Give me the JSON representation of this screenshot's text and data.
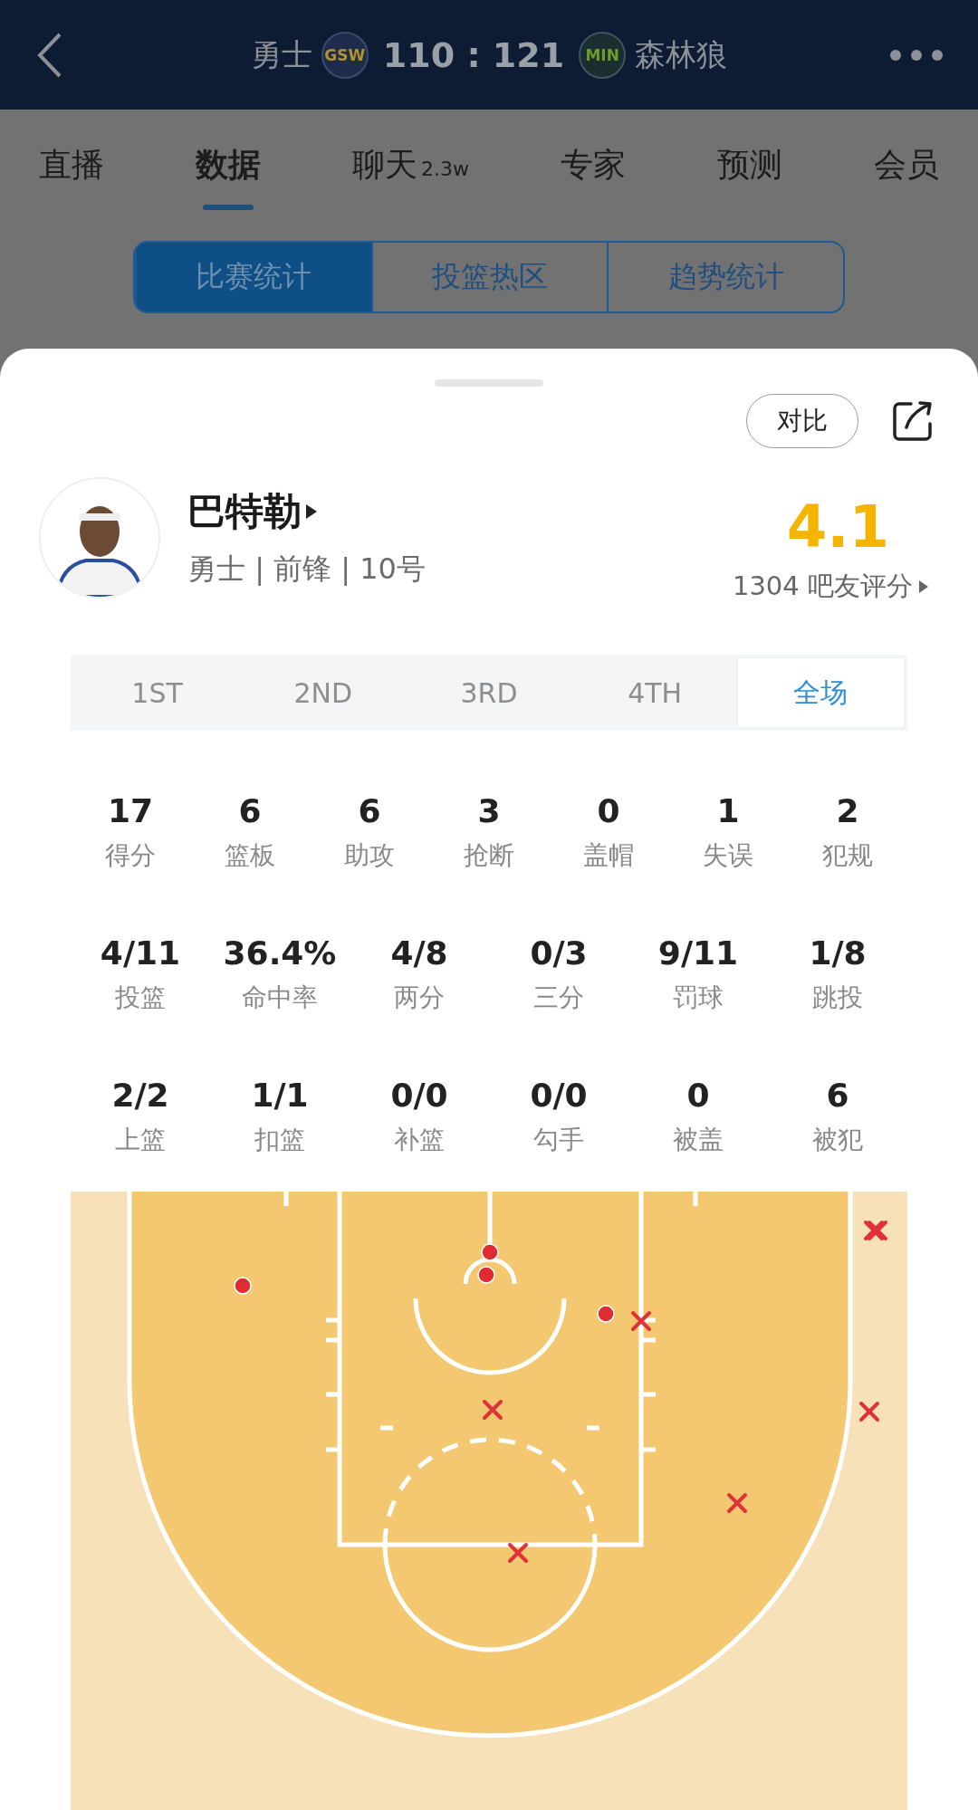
{
  "header": {
    "home_team": "勇士",
    "home_logo": "GSW",
    "score": "110 : 121",
    "away_logo": "MIN",
    "away_team": "森林狼"
  },
  "nav_tabs": [
    {
      "label": "直播",
      "selected": false
    },
    {
      "label": "数据",
      "selected": true
    },
    {
      "label": "聊天",
      "badge": "2.3w",
      "selected": false
    },
    {
      "label": "专家",
      "selected": false
    },
    {
      "label": "预测",
      "selected": false
    },
    {
      "label": "会员",
      "selected": false
    }
  ],
  "segments": [
    {
      "label": "比赛统计",
      "selected": true
    },
    {
      "label": "投篮热区",
      "selected": false
    },
    {
      "label": "趋势统计",
      "selected": false
    }
  ],
  "player": {
    "compare_button": "对比",
    "name": "巴特勒",
    "info": "勇士 | 前锋 | 10号",
    "rating": "4.1",
    "rating_count": "1304 吧友评分"
  },
  "periods": [
    {
      "label": "1ST",
      "selected": false
    },
    {
      "label": "2ND",
      "selected": false
    },
    {
      "label": "3RD",
      "selected": false
    },
    {
      "label": "4TH",
      "selected": false
    },
    {
      "label": "全场",
      "selected": true
    }
  ],
  "stats_rows": [
    [
      {
        "value": "17",
        "label": "得分"
      },
      {
        "value": "6",
        "label": "篮板"
      },
      {
        "value": "6",
        "label": "助攻"
      },
      {
        "value": "3",
        "label": "抢断"
      },
      {
        "value": "0",
        "label": "盖帽"
      },
      {
        "value": "1",
        "label": "失误"
      },
      {
        "value": "2",
        "label": "犯规"
      }
    ],
    [
      {
        "value": "4/11",
        "label": "投篮"
      },
      {
        "value": "36.4%",
        "label": "命中率"
      },
      {
        "value": "4/8",
        "label": "两分"
      },
      {
        "value": "0/3",
        "label": "三分"
      },
      {
        "value": "9/11",
        "label": "罚球"
      },
      {
        "value": "1/8",
        "label": "跳投"
      }
    ],
    [
      {
        "value": "2/2",
        "label": "上篮"
      },
      {
        "value": "1/1",
        "label": "扣篮"
      },
      {
        "value": "0/0",
        "label": "补篮"
      },
      {
        "value": "0/0",
        "label": "勾手"
      },
      {
        "value": "0",
        "label": "被盖"
      },
      {
        "value": "6",
        "label": "被犯"
      }
    ]
  ],
  "shot_chart": {
    "shots": [
      {
        "kind": "made"
      },
      {
        "kind": "made"
      },
      {
        "kind": "made"
      },
      {
        "kind": "made"
      },
      {
        "kind": "missed"
      },
      {
        "kind": "missed"
      },
      {
        "kind": "missed"
      },
      {
        "kind": "missed"
      },
      {
        "kind": "missed"
      },
      {
        "kind": "missed"
      },
      {
        "kind": "missed"
      }
    ]
  }
}
